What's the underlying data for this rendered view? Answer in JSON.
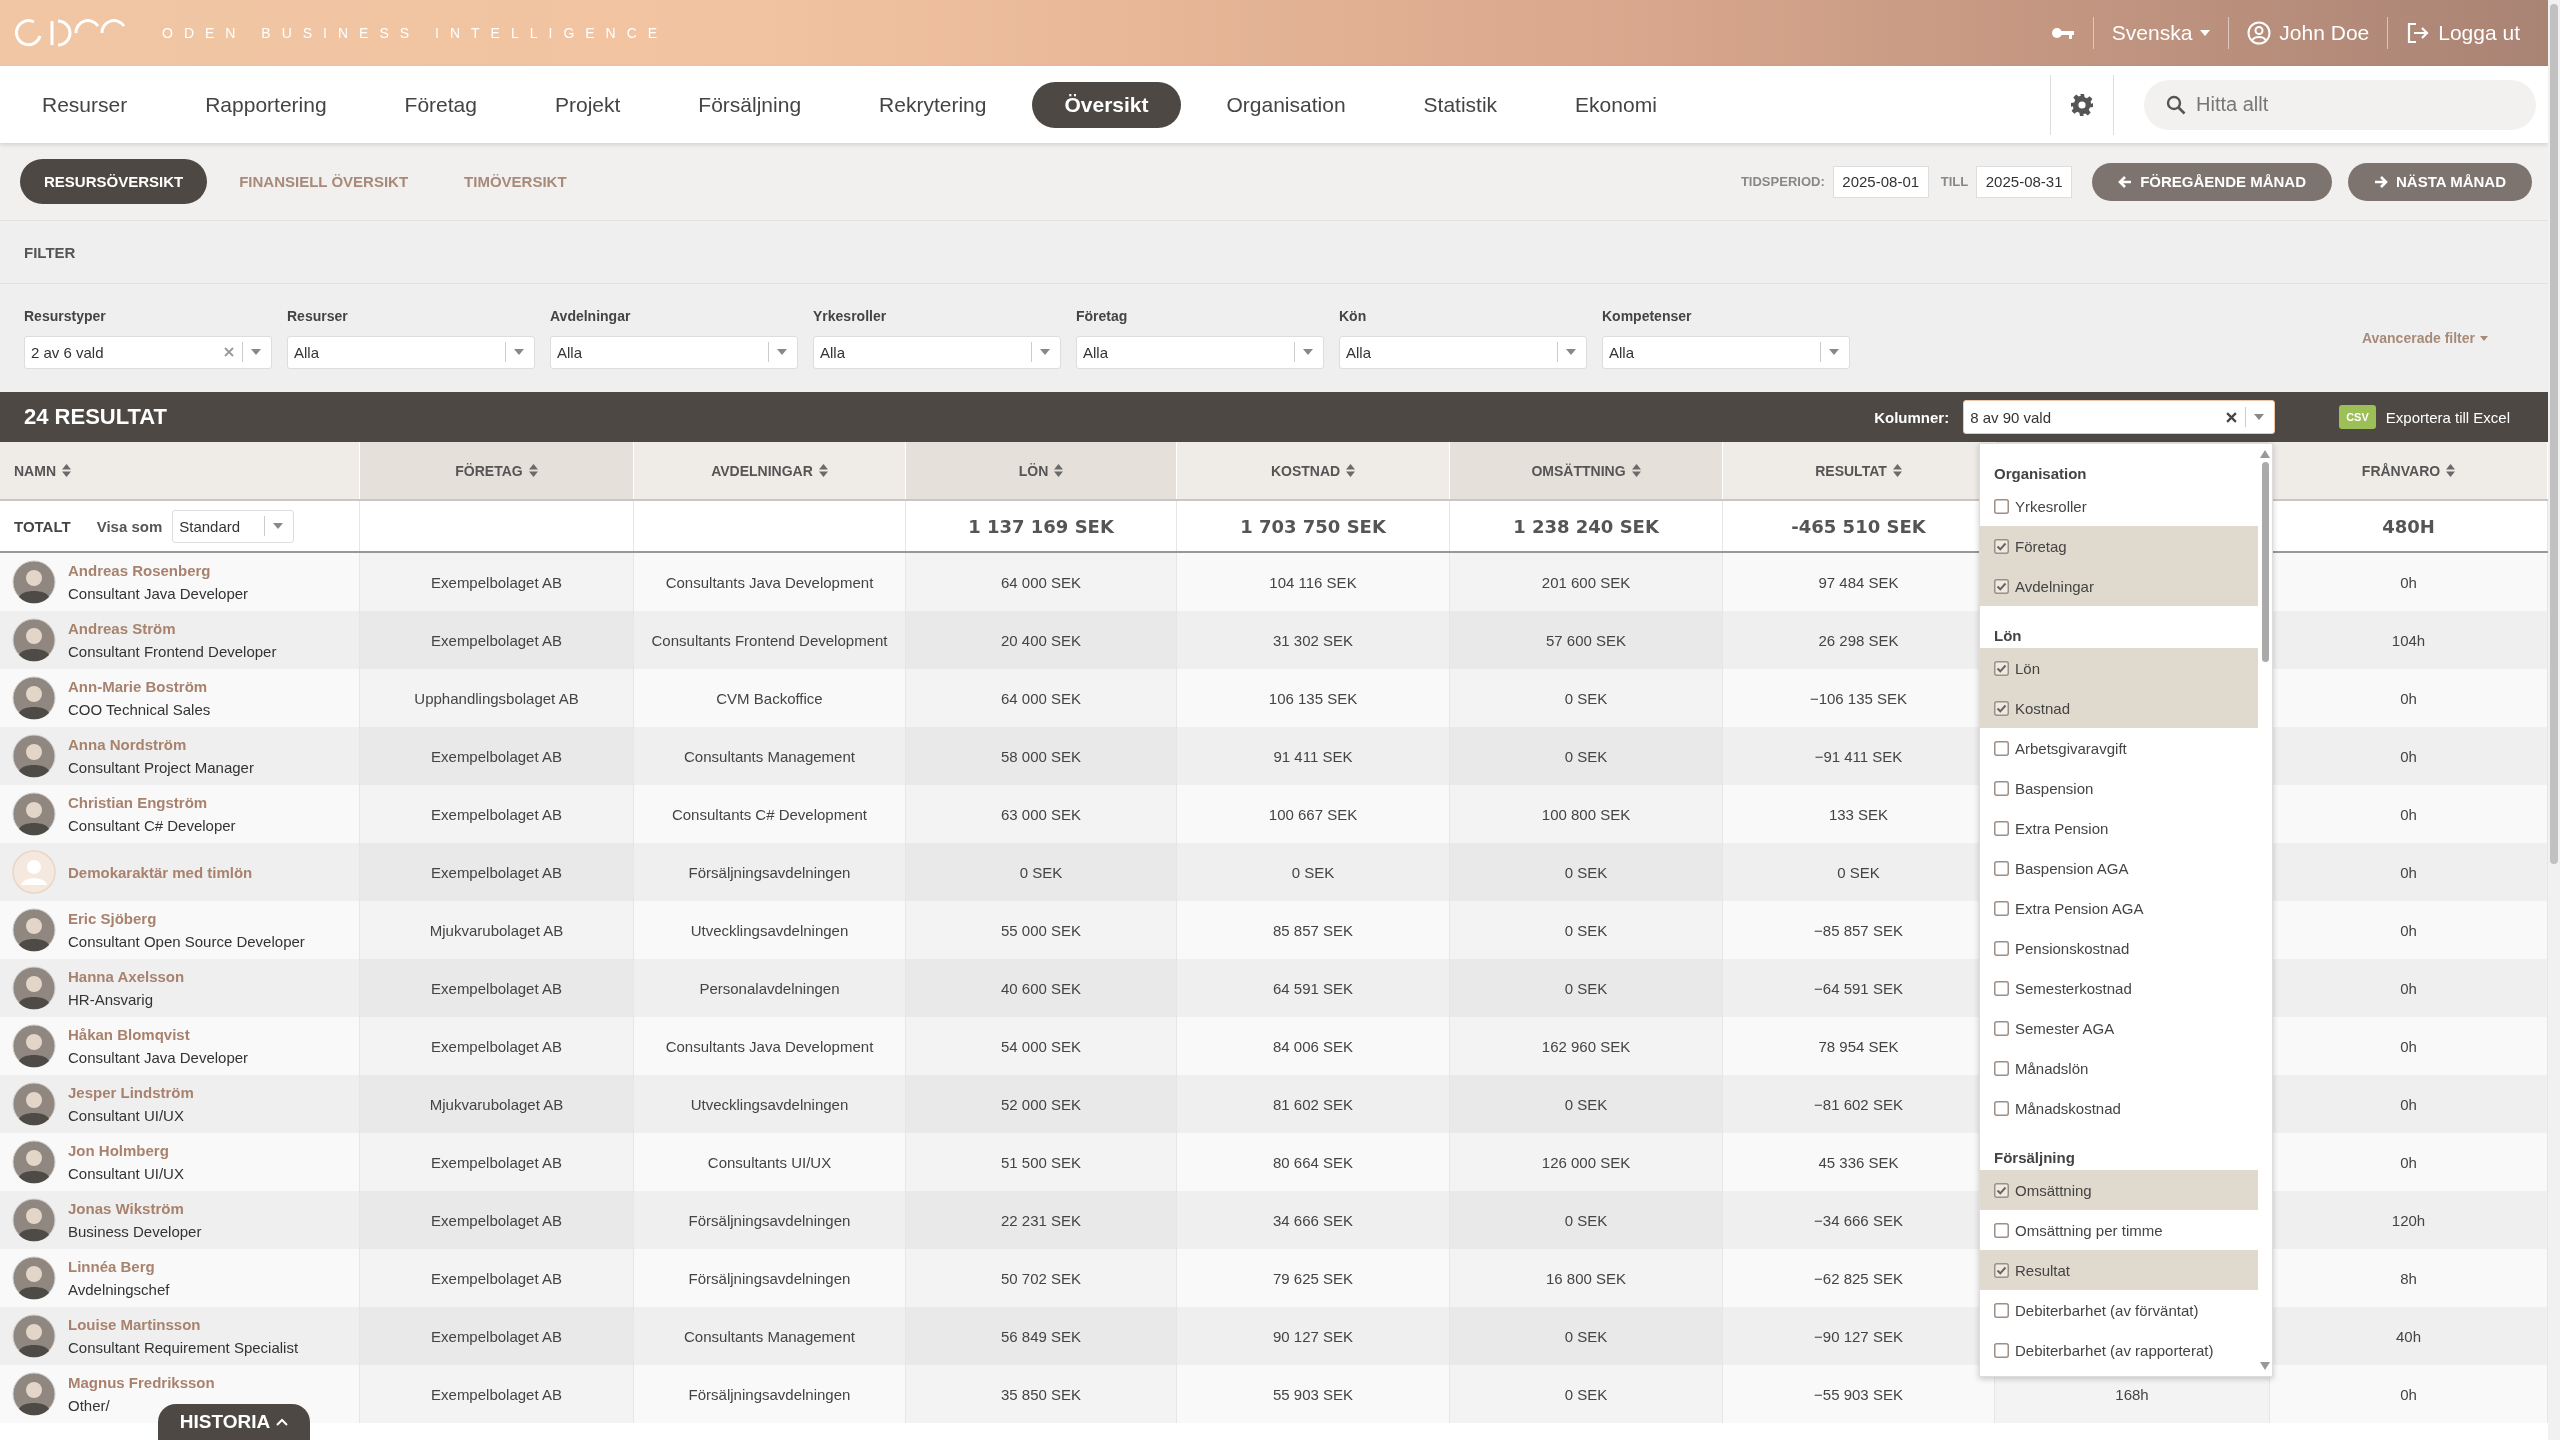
{
  "header": {
    "brand": "ODEN BUSINESS INTELLIGENCE",
    "language": "Svenska",
    "user": "John Doe",
    "logout": "Logga ut"
  },
  "nav": {
    "items": [
      {
        "label": "Resurser",
        "selected": false
      },
      {
        "label": "Rapportering",
        "selected": false
      },
      {
        "label": "Företag",
        "selected": false
      },
      {
        "label": "Projekt",
        "selected": false
      },
      {
        "label": "Försäljning",
        "selected": false
      },
      {
        "label": "Rekrytering",
        "selected": false
      },
      {
        "label": "Översikt",
        "selected": true
      },
      {
        "label": "Organisation",
        "selected": false
      },
      {
        "label": "Statistik",
        "selected": false
      },
      {
        "label": "Ekonomi",
        "selected": false
      }
    ],
    "search": {
      "placeholder": "Hitta allt"
    }
  },
  "subnav": {
    "tabs": [
      {
        "label": "RESURSÖVERSIKT",
        "selected": true
      },
      {
        "label": "FINANSIELL ÖVERSIKT",
        "selected": false
      },
      {
        "label": "TIMÖVERSIKT",
        "selected": false
      }
    ],
    "period_label": "TIDSPERIOD:",
    "from": "2025-08-01",
    "till_label": "TILL",
    "till": "2025-08-31",
    "prev": "FÖREGÅENDE MÅNAD",
    "next": "NÄSTA MÅNAD"
  },
  "filter": {
    "title": "FILTER",
    "fields": [
      {
        "label": "Resurstyper",
        "value": "2 av 6 vald",
        "clearable": true
      },
      {
        "label": "Resurser",
        "value": "Alla",
        "clearable": false
      },
      {
        "label": "Avdelningar",
        "value": "Alla",
        "clearable": false
      },
      {
        "label": "Yrkesroller",
        "value": "Alla",
        "clearable": false
      },
      {
        "label": "Företag",
        "value": "Alla",
        "clearable": false
      },
      {
        "label": "Kön",
        "value": "Alla",
        "clearable": false
      },
      {
        "label": "Kompetenser",
        "value": "Alla",
        "clearable": false
      }
    ],
    "advanced": "Avancerade filter"
  },
  "results": {
    "count": "24 RESULTAT",
    "columns_label": "Kolumner:",
    "columns_value": "8 av 90 vald",
    "csv": "CSV",
    "export": "Exportera till Excel"
  },
  "table": {
    "columns": [
      {
        "label": "NAMN"
      },
      {
        "label": "FÖRETAG"
      },
      {
        "label": "AVDELNINGAR"
      },
      {
        "label": "LÖN"
      },
      {
        "label": "KOSTNAD"
      },
      {
        "label": "OMSÄTTNING"
      },
      {
        "label": "RESULTAT"
      },
      {},
      {
        "label": "FRÅNVARO"
      }
    ],
    "total": {
      "label": "TOTALT",
      "view_label": "Visa som",
      "view": "Standard",
      "salary": "1 137 169 SEK",
      "cost": "1 703 750 SEK",
      "revenue": "1 238 240 SEK",
      "result": "-465 510 SEK",
      "absence": "480H"
    },
    "rows": [
      {
        "name": "Andreas Rosenberg",
        "title": "Consultant Java Developer",
        "has_photo": true,
        "company": "Exempelbolaget AB",
        "department": "Consultants Java Development",
        "salary": "64 000 SEK",
        "cost": "104 116 SEK",
        "revenue": "201 600 SEK",
        "result": "97 484 SEK",
        "absence": "0h"
      },
      {
        "name": "Andreas Ström",
        "title": "Consultant Frontend Developer",
        "has_photo": true,
        "company": "Exempelbolaget AB",
        "department": "Consultants Frontend Development",
        "salary": "20 400 SEK",
        "cost": "31 302 SEK",
        "revenue": "57 600 SEK",
        "result": "26 298 SEK",
        "absence": "104h"
      },
      {
        "name": "Ann-Marie Boström",
        "title": "COO Technical Sales",
        "has_photo": true,
        "company": "Upphandlingsbolaget AB",
        "department": "CVM Backoffice",
        "salary": "64 000 SEK",
        "cost": "106 135 SEK",
        "revenue": "0 SEK",
        "result": "−106 135 SEK",
        "absence": "0h"
      },
      {
        "name": "Anna Nordström",
        "title": "Consultant Project Manager",
        "has_photo": true,
        "company": "Exempelbolaget AB",
        "department": "Consultants Management",
        "salary": "58 000 SEK",
        "cost": "91 411 SEK",
        "revenue": "0 SEK",
        "result": "−91 411 SEK",
        "absence": "0h"
      },
      {
        "name": "Christian Engström",
        "title": "Consultant C# Developer",
        "has_photo": true,
        "company": "Exempelbolaget AB",
        "department": "Consultants C# Development",
        "salary": "63 000 SEK",
        "cost": "100 667 SEK",
        "revenue": "100 800 SEK",
        "result": "133 SEK",
        "absence": "0h"
      },
      {
        "name": "Demokaraktär med timlön",
        "has_photo": false,
        "company": "Exempelbolaget AB",
        "department": "Försäljningsavdelningen",
        "salary": "0 SEK",
        "cost": "0 SEK",
        "revenue": "0 SEK",
        "result": "0 SEK",
        "absence": "0h"
      },
      {
        "name": "Eric Sjöberg",
        "title": "Consultant Open Source Developer",
        "has_photo": true,
        "company": "Mjukvarubolaget AB",
        "department": "Utvecklingsavdelningen",
        "salary": "55 000 SEK",
        "cost": "85 857 SEK",
        "revenue": "0 SEK",
        "result": "−85 857 SEK",
        "absence": "0h"
      },
      {
        "name": "Hanna Axelsson",
        "title": "HR-Ansvarig",
        "has_photo": true,
        "company": "Exempelbolaget AB",
        "department": "Personalavdelningen",
        "salary": "40 600 SEK",
        "cost": "64 591 SEK",
        "revenue": "0 SEK",
        "result": "−64 591 SEK",
        "absence": "0h"
      },
      {
        "name": "Håkan Blomqvist",
        "title": "Consultant Java Developer",
        "has_photo": true,
        "company": "Exempelbolaget AB",
        "department": "Consultants Java Development",
        "salary": "54 000 SEK",
        "cost": "84 006 SEK",
        "revenue": "162 960 SEK",
        "result": "78 954 SEK",
        "absence": "0h"
      },
      {
        "name": "Jesper Lindström",
        "title": "Consultant UI/UX",
        "has_photo": true,
        "company": "Mjukvarubolaget AB",
        "department": "Utvecklingsavdelningen",
        "salary": "52 000 SEK",
        "cost": "81 602 SEK",
        "revenue": "0 SEK",
        "result": "−81 602 SEK",
        "absence": "0h"
      },
      {
        "name": "Jon Holmberg",
        "title": "Consultant UI/UX",
        "has_photo": true,
        "company": "Exempelbolaget AB",
        "department": "Consultants UI/UX",
        "salary": "51 500 SEK",
        "cost": "80 664 SEK",
        "revenue": "126 000 SEK",
        "result": "45 336 SEK",
        "absence": "0h"
      },
      {
        "name": "Jonas Wikström",
        "title": "Business Developer",
        "has_photo": true,
        "company": "Exempelbolaget AB",
        "department": "Försäljningsavdelningen",
        "salary": "22 231 SEK",
        "cost": "34 666 SEK",
        "revenue": "0 SEK",
        "result": "−34 666 SEK",
        "absence": "120h"
      },
      {
        "name": "Linnéa Berg",
        "title": "Avdelningschef",
        "has_photo": true,
        "company": "Exempelbolaget AB",
        "department": "Försäljningsavdelningen",
        "salary": "50 702 SEK",
        "cost": "79 625 SEK",
        "revenue": "16 800 SEK",
        "result": "−62 825 SEK",
        "absence": "8h"
      },
      {
        "name": "Louise Martinsson",
        "title": "Consultant Requirement Specialist",
        "has_photo": true,
        "company": "Exempelbolaget AB",
        "department": "Consultants Management",
        "salary": "56 849 SEK",
        "cost": "90 127 SEK",
        "revenue": "0 SEK",
        "result": "−90 127 SEK",
        "absence": "40h"
      },
      {
        "name": "Magnus Fredriksson",
        "title": "Other/",
        "has_photo": true,
        "company": "Exempelbolaget AB",
        "department": "Försäljningsavdelningen",
        "salary": "35 850 SEK",
        "cost": "55 903 SEK",
        "revenue": "0 SEK",
        "result": "−55 903 SEK",
        "column_8": "168h",
        "absence": "0h"
      }
    ]
  },
  "column_picker": {
    "groups": [
      {
        "title": "Organisation",
        "options": [
          {
            "label": "Yrkesroller",
            "checked": false
          },
          {
            "label": "Företag",
            "checked": true
          },
          {
            "label": "Avdelningar",
            "checked": true
          }
        ]
      },
      {
        "title": "Lön",
        "options": [
          {
            "label": "Lön",
            "checked": true
          },
          {
            "label": "Kostnad",
            "checked": true
          },
          {
            "label": "Arbetsgivaravgift",
            "checked": false
          },
          {
            "label": "Baspension",
            "checked": false
          },
          {
            "label": "Extra Pension",
            "checked": false
          },
          {
            "label": "Baspension AGA",
            "checked": false
          },
          {
            "label": "Extra Pension AGA",
            "checked": false
          },
          {
            "label": "Pensionskostnad",
            "checked": false
          },
          {
            "label": "Semesterkostnad",
            "checked": false
          },
          {
            "label": "Semester AGA",
            "checked": false
          },
          {
            "label": "Månadslön",
            "checked": false
          },
          {
            "label": "Månadskostnad",
            "checked": false
          }
        ]
      },
      {
        "title": "Försäljning",
        "options": [
          {
            "label": "Omsättning",
            "checked": true
          },
          {
            "label": "Omsättning per timme",
            "checked": false
          },
          {
            "label": "Resultat",
            "checked": true
          },
          {
            "label": "Debiterbarhet (av förväntat)",
            "checked": false
          },
          {
            "label": "Debiterbarhet (av rapporterat)",
            "checked": false
          }
        ]
      }
    ]
  },
  "history_tab": "HISTORIA"
}
